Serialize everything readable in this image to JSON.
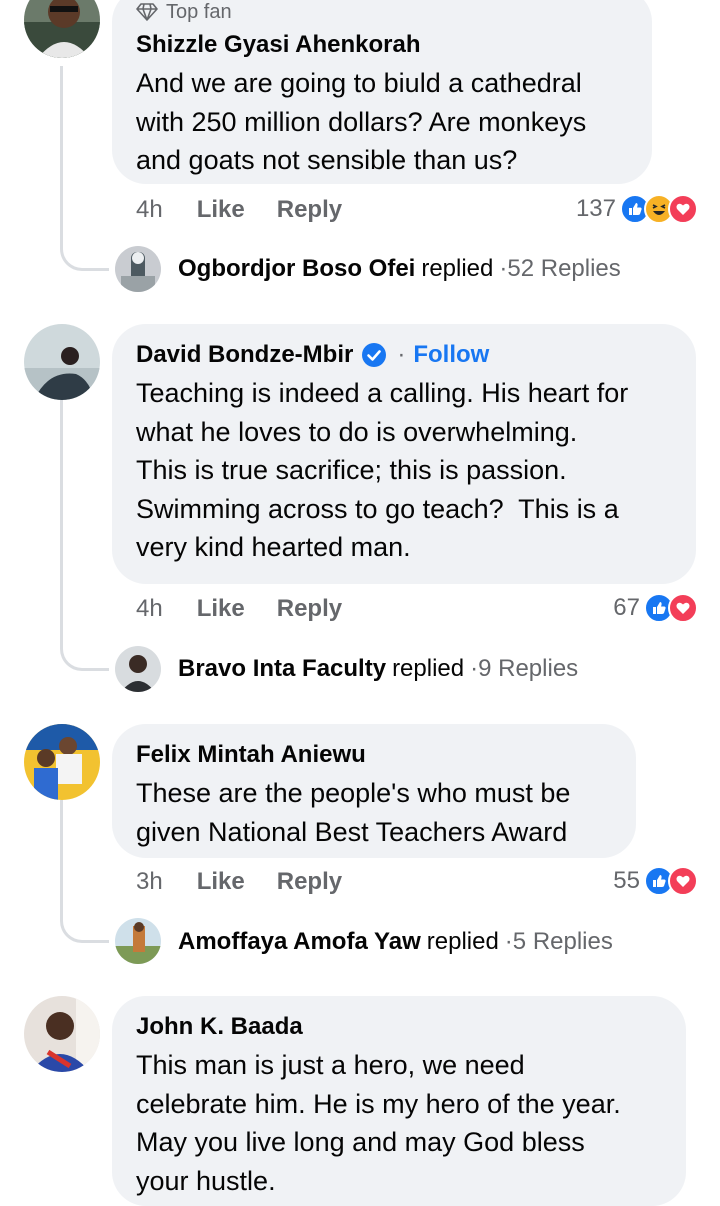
{
  "comments": [
    {
      "badge": "Top fan",
      "author": "Shizzle Gyasi Ahenkorah",
      "lines": [
        "And we are going to biuld a cathedral",
        "with 250 million dollars? Are monkeys",
        "and goats not sensible than us?"
      ],
      "time": "4h",
      "like": "Like",
      "reply": "Reply",
      "reaction_count": "137",
      "reactions": [
        "like-icon",
        "haha-icon",
        "love-icon"
      ],
      "replier": "Ogbordjor Boso Ofei",
      "replied": "replied",
      "replies": "52 Replies"
    },
    {
      "author": "David Bondze-Mbir",
      "follow": "Follow",
      "lines": [
        "Teaching is indeed a calling. His heart for",
        "what he loves to do is overwhelming.",
        "This is true sacrifice; this is passion.",
        "Swimming across to go teach?  This is a",
        "very kind hearted man."
      ],
      "time": "4h",
      "like": "Like",
      "reply": "Reply",
      "reaction_count": "67",
      "reactions": [
        "like-icon",
        "love-icon"
      ],
      "replier": "Bravo Inta Faculty",
      "replied": "replied",
      "replies": "9 Replies"
    },
    {
      "author": "Felix Mintah Aniewu",
      "lines": [
        "These are the people's who must be",
        "given National Best Teachers Award"
      ],
      "time": "3h",
      "like": "Like",
      "reply": "Reply",
      "reaction_count": "55",
      "reactions": [
        "like-icon",
        "love-icon"
      ],
      "replier": "Amoffaya Amofa Yaw",
      "replied": "replied",
      "replies": "5 Replies"
    },
    {
      "author": "John K. Baada",
      "lines": [
        "This man is just a hero, we need",
        "celebrate him. He is my hero of the year.",
        "May you live long and may God bless",
        "your hustle."
      ]
    }
  ],
  "colors": {
    "bubble": "#f0f2f5",
    "link": "#1877f2",
    "meta": "#65676b",
    "like": "#1877f2",
    "love": "#f33e58",
    "haha": "#f7b125"
  }
}
